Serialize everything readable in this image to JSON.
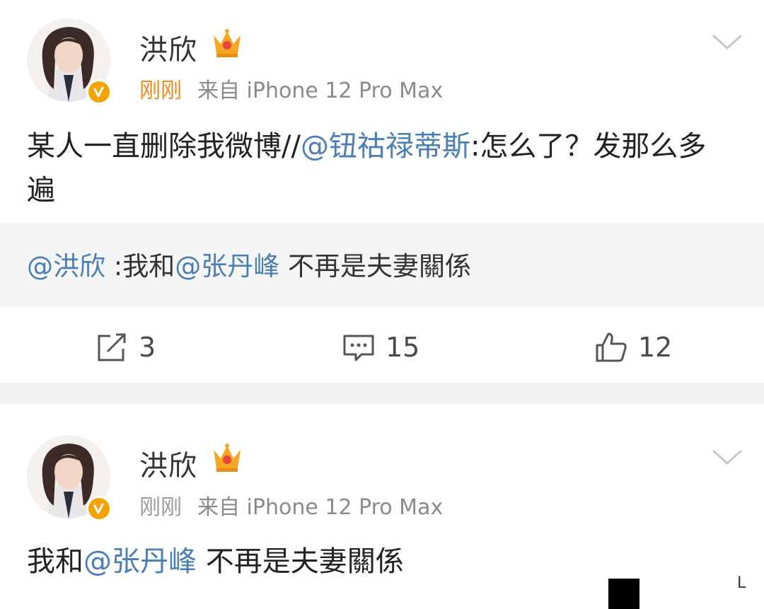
{
  "posts": [
    {
      "user_name": "洪欣",
      "time": "刚刚",
      "source": "来自 iPhone 12 Pro Max",
      "text_segments": [
        {
          "text": "某人一直删除我微博//",
          "type": "plain"
        },
        {
          "text": "@钮祜禄蒂斯",
          "type": "mention"
        },
        {
          "text": ":怎么了？发那么多遍",
          "type": "plain"
        }
      ],
      "quote_segments": [
        {
          "text": "@洪欣",
          "type": "mention"
        },
        {
          "text": " :我和",
          "type": "plain"
        },
        {
          "text": "@张丹峰",
          "type": "mention"
        },
        {
          "text": " 不再是夫妻關係",
          "type": "plain"
        }
      ],
      "actions": {
        "repost_count": "3",
        "comment_count": "15",
        "like_count": "12"
      }
    },
    {
      "user_name": "洪欣",
      "time": "刚刚",
      "source": "来自 iPhone 12 Pro Max",
      "text_segments": [
        {
          "text": "我和",
          "type": "plain"
        },
        {
          "text": "@张丹峰",
          "type": "mention"
        },
        {
          "text": " 不再是夫妻關係",
          "type": "plain"
        }
      ]
    }
  ],
  "corner_mark": "L",
  "icons": {
    "more": "chevron-down-icon",
    "repost": "share-icon",
    "comment": "comment-icon",
    "like": "thumbs-up-icon",
    "verified": "verified-badge-icon",
    "vip": "crown-badge-icon"
  },
  "colors": {
    "mention": "#4a7fb5",
    "time_highlight": "#f08a1d",
    "verified_badge": "#f5a300",
    "quote_bg": "#f5f5f5"
  }
}
